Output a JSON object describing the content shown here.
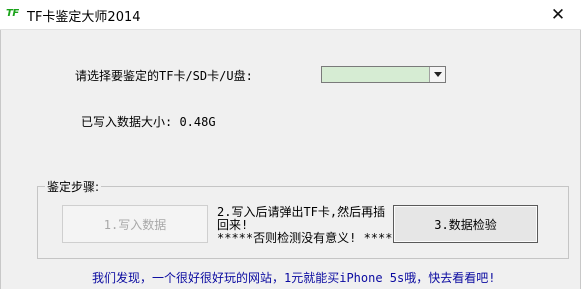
{
  "window": {
    "icon_text": "TF",
    "title": "TF卡鉴定大师2014",
    "close_glyph": "✕"
  },
  "form": {
    "select_label": "请选择要鉴定的TF卡/SD卡/U盘:",
    "select_value": "",
    "written_size_label": "已写入数据大小: 0.48G"
  },
  "steps": {
    "group_title": "鉴定步骤:",
    "write_button": "1.写入数据",
    "instruction_line1": "2.写入后请弹出TF卡,然后再插",
    "instruction_line2": "回来!",
    "instruction_line3": "*****否则检测没有意义! *****",
    "check_button": "3.数据检验"
  },
  "footer": {
    "link_text": "我们发现，一个很好很好玩的网站，1元就能买iPhone 5s哦，快去看看吧!"
  }
}
